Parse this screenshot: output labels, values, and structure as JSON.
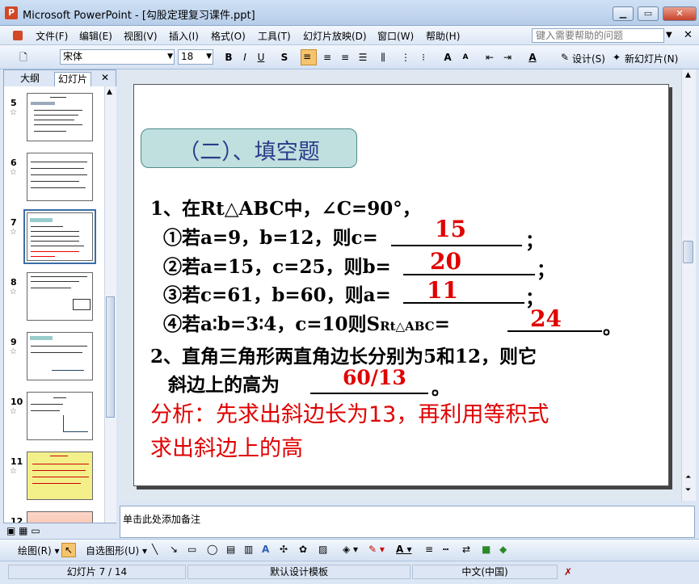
{
  "window": {
    "title": "Microsoft PowerPoint - [勾股定理复习课件.ppt]",
    "app_icon": "P"
  },
  "menu": [
    "文件(F)",
    "编辑(E)",
    "视图(V)",
    "插入(I)",
    "格式(O)",
    "工具(T)",
    "幻灯片放映(D)",
    "窗口(W)",
    "帮助(H)"
  ],
  "help_placeholder": "键入需要帮助的问题",
  "toolbar": {
    "font": "宋体",
    "size": "18",
    "bold": "B",
    "italic": "I",
    "underline": "U",
    "shadow": "S",
    "design": "设计(S)",
    "new_slide": "新幻灯片(N)"
  },
  "pane": {
    "tab_outline": "大纲",
    "tab_slides": "幻灯片"
  },
  "thumbs": [
    {
      "num": "5",
      "top": 0
    },
    {
      "num": "6",
      "top": 0
    },
    {
      "num": "7",
      "top": 0
    },
    {
      "num": "8",
      "top": 0
    },
    {
      "num": "9",
      "top": 0
    },
    {
      "num": "10",
      "top": 0
    },
    {
      "num": "11",
      "top": 0
    },
    {
      "num": "12",
      "top": 0
    }
  ],
  "slide": {
    "heading": "（二）、填空题",
    "q1": "1、在Rt△ABC中，∠C=90°，",
    "q1a": "①若a=9，b=12，则c=",
    "q1b": "②若a=15，c=25，则b=",
    "q1c": "③若c=61，b=60，则a=",
    "q1d_pre": "④若a∶b=3∶4，c=10则S",
    "q1d_sub": "Rt△ABC",
    "q1d_eq": "=",
    "semi": "；",
    "period": "。",
    "ans1": "15",
    "ans2": "20",
    "ans3": "11",
    "ans4": "24",
    "q2_line1": "2、直角三角形两直角边长分别为5和12，则它",
    "q2_line2": "斜边上的高为",
    "ans5": "60/13",
    "analysis_line1": "分析：先求出斜边长为13，再利用等积式",
    "analysis_line2": "求出斜边上的高"
  },
  "notes": "单击此处添加备注",
  "draw": {
    "draw_label": "绘图(R)",
    "autoshape": "自选图形(U)"
  },
  "status": {
    "slide": "幻灯片 7 / 14",
    "template": "默认设计模板",
    "lang": "中文(中国)"
  }
}
